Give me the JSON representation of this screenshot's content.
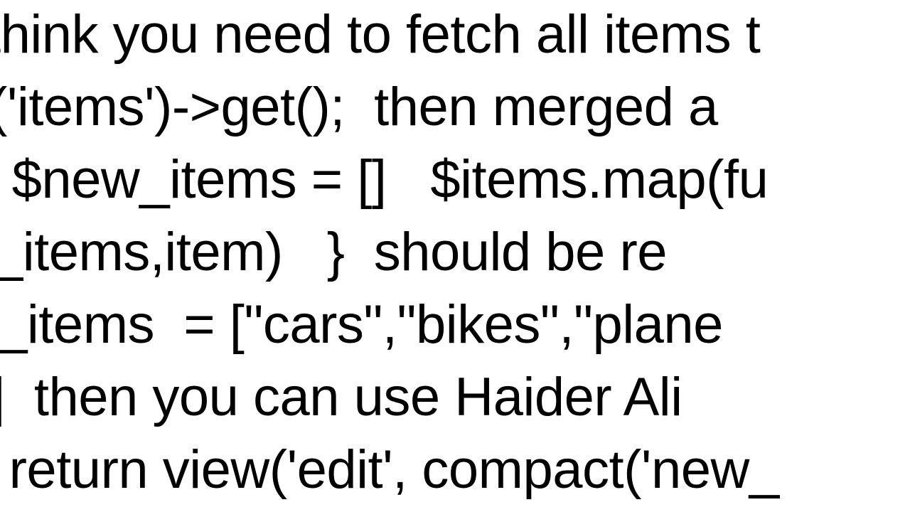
{
  "lines": {
    "l1": "think you need to fetch all items t",
    "l2": "ct('items')->get();  then merged a",
    "l3": " $new_items = []   $items.map(fu",
    "l4": "new_items,item)   }  should be re",
    "l5": "ew_items  = [\"cars\",\"bikes\",\"plane",
    "l6": "s\"]  then you can use Haider Ali ",
    "l7": " return view('edit', compact('new_"
  }
}
